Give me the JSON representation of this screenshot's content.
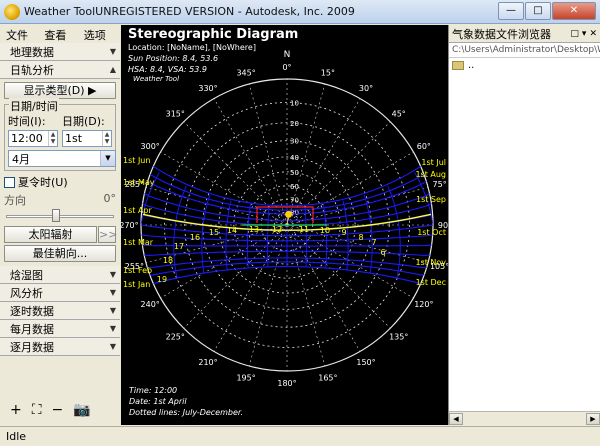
{
  "window": {
    "title": "Weather ToolUNREGISTERED VERSION  -  Autodesk, Inc. 2009",
    "buttons": [
      "—",
      "□",
      "✕"
    ]
  },
  "menu": [
    "文件(F)",
    "查看(V)",
    "选项(O)"
  ],
  "sidebar": {
    "sections_top": [
      "地理数据",
      "日轨分析"
    ],
    "display_type_label": "显示类型(D)",
    "datetime_group_label": "日期/时间",
    "time_label": "时间(I):",
    "date_label": "日期(D):",
    "time_value": "12:00",
    "date_value": "1st",
    "month_value": "4月",
    "dst_label": "夏令时(U)",
    "direction_label": "方向",
    "direction_value": "0°",
    "solar_radiation_label": "太阳辐射",
    "solar_radiation_more": ">>",
    "optimal_orientation_label": "最佳朝向...",
    "sections_bottom": [
      "焓湿图",
      "风分析",
      "逐时数据",
      "每月数据",
      "逐月数据"
    ]
  },
  "bottom_tools": [
    "+",
    "⛶",
    "−",
    "📷"
  ],
  "chart": {
    "title": "Stereographic Diagram",
    "location": "Location: [NoName], [NoWhere]",
    "sun_position": "Sun Position: 8.4,  53.6",
    "hsa_vsa": "HSA: 8.4,  VSA: 53.9",
    "brand": "Weather Tool",
    "footer_time": "Time: 12:00",
    "footer_date": "Date: 1st April",
    "footer_note": "Dotted lines: July-December.",
    "north_label": "N",
    "azimuth_labels": [
      "0°",
      "15°",
      "30°",
      "45°",
      "60°",
      "75°",
      "90°",
      "105°",
      "120°",
      "135°",
      "150°",
      "165°",
      "180°",
      "195°",
      "210°",
      "225°",
      "240°",
      "255°",
      "270°",
      "285°",
      "300°",
      "315°",
      "330°",
      "345°"
    ],
    "altitude_labels": [
      "10",
      "20",
      "30",
      "40",
      "50",
      "60",
      "70",
      "80"
    ],
    "left_date_labels": [
      "1st Jun",
      "1st May",
      "1st Apr",
      "1st Mar",
      "1st Feb",
      "1st Jan"
    ],
    "right_date_labels": [
      "1st Jul",
      "1st Aug",
      "1st Sep",
      "1st Oct",
      "1st Nov",
      "1st Dec"
    ],
    "hour_labels": [
      "6",
      "7",
      "8",
      "9",
      "10",
      "11",
      "12",
      "13",
      "14",
      "15",
      "16",
      "17",
      "18",
      "19"
    ],
    "colors": {
      "background": "#000000",
      "grid": "#ffffff",
      "sunpath": "#1a1aff",
      "highlight_path": "#ffff33",
      "label_yellow": "#ffff00",
      "marker": "#ff2222",
      "sun": "#ffcc00"
    }
  },
  "file_browser": {
    "title": "气象数据文件浏览器",
    "icons": [
      "□",
      "▾",
      "✕"
    ],
    "path": "C:\\Users\\Administrator\\Desktop\\Wea",
    "items": [
      ".."
    ]
  },
  "status": "Idle"
}
